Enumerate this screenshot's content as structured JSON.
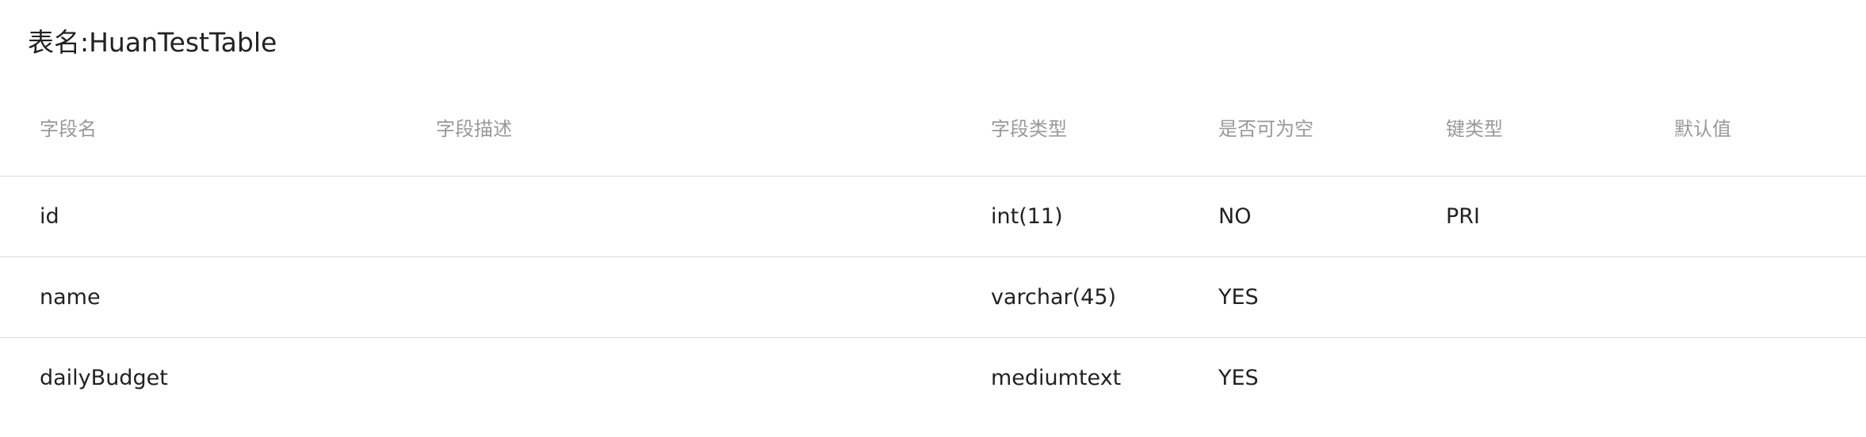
{
  "table_title": "表名:HuanTestTable",
  "columns": {
    "name": "字段名",
    "description": "字段描述",
    "type": "字段类型",
    "nullable": "是否可为空",
    "key": "键类型",
    "default": "默认值"
  },
  "rows": [
    {
      "name": "id",
      "description": "",
      "type": "int(11)",
      "nullable": "NO",
      "key": "PRI",
      "default": ""
    },
    {
      "name": "name",
      "description": "",
      "type": "varchar(45)",
      "nullable": "YES",
      "key": "",
      "default": ""
    },
    {
      "name": "dailyBudget",
      "description": "",
      "type": "mediumtext",
      "nullable": "YES",
      "key": "",
      "default": ""
    }
  ]
}
